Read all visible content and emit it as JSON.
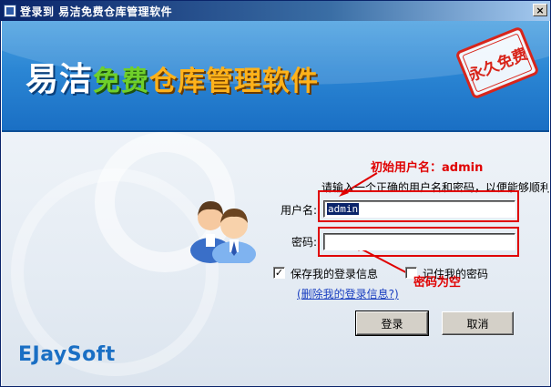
{
  "window": {
    "title": "登录到 易洁免费仓库管理软件",
    "close_label": "×"
  },
  "banner": {
    "title_part1": "易洁",
    "title_part2": "免费",
    "title_part3": "仓库管理软件",
    "stamp": "永久免费"
  },
  "annotations": {
    "initial_username": "初始用户名：admin",
    "password_empty": "密码为空"
  },
  "form": {
    "hint": "请输入一个正确的用户名和密码，以便能够顺利",
    "username_label": "用户名:",
    "username_value": "admin",
    "password_label": "密码:",
    "password_value": "",
    "save_login_label": "保存我的登录信息",
    "save_login_checked": true,
    "remember_password_label": "记住我的密码",
    "remember_password_checked": false,
    "delete_login_link": "(删除我的登录信息?)",
    "login_button": "登录",
    "cancel_button": "取消"
  },
  "brand": {
    "logo_text": "EJaySoft"
  },
  "colors": {
    "banner_blue": "#2b86d4",
    "annotation_red": "#e00000",
    "link_blue": "#1a3fc0"
  }
}
